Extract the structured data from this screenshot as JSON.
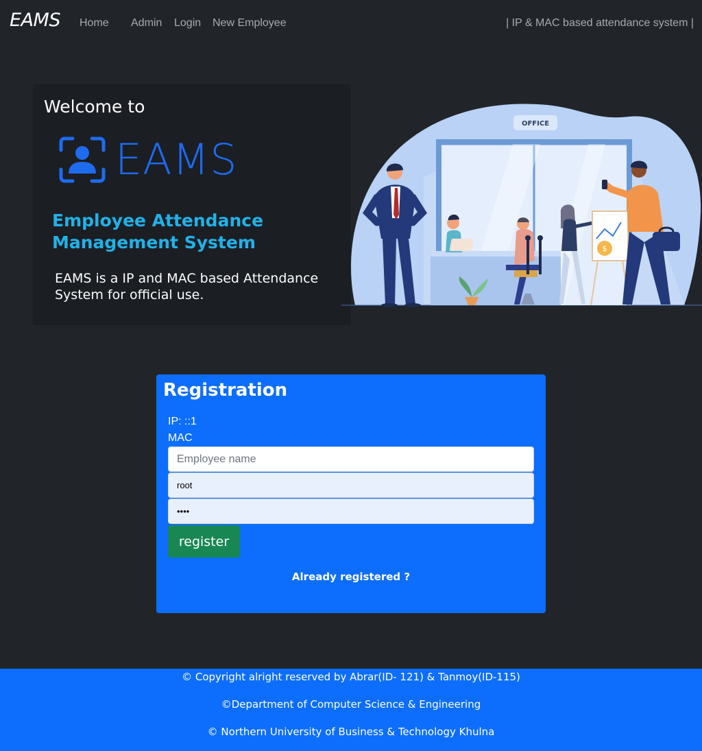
{
  "navbar": {
    "brand": "EAMS",
    "links": [
      "Home",
      "Admin",
      "Login",
      "New Employee"
    ],
    "tagline": "| IP & MAC based attendance system |"
  },
  "welcome": {
    "title": "Welcome to",
    "logo_text": "EAMS",
    "logo_icon": "user-scan-icon",
    "system_title": "Employee Attendance Management System",
    "description": "EAMS is a IP and MAC based Attendance System for official use."
  },
  "illustration": {
    "sign_text": "OFFICE"
  },
  "registration": {
    "title": "Registration",
    "ip_label": "IP: ::1",
    "mac_label": "MAC",
    "name_placeholder": "Employee name",
    "username_value": "root",
    "password_value": "••••",
    "register_label": "register",
    "already_label": "Already registered ?"
  },
  "footer": {
    "line1": "© Copyright alright reserved by Abrar(ID- 121) & Tanmoy(ID-115)",
    "line2": "©Department of Computer Science & Engineering",
    "line3": "© Northern University of Business & Technology Khulna"
  },
  "colors": {
    "background": "#212529",
    "primary": "#0d6efd",
    "success": "#198754",
    "logo_blue": "#1e6bf0",
    "accent_cyan": "#21b2e8"
  }
}
